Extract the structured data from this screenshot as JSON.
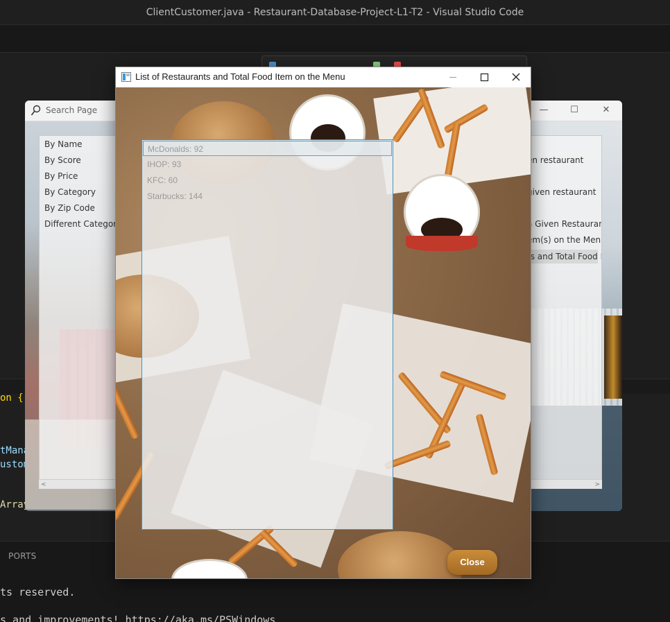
{
  "vscode": {
    "title": "ClientCustomer.java - Restaurant-Database-Project-L1-T2 - Visual Studio Code",
    "code_lines": [
      "on {",
      "tMana",
      "ustom",
      "Array"
    ],
    "panel_tab": "PORTS",
    "terminal_lines": [
      "ts reserved.",
      "s and improvements! https://aka.ms/PSWindows"
    ]
  },
  "left_window": {
    "search_label": "Search Page",
    "items": [
      "By Name",
      "By Score",
      "By Price",
      "By Category",
      "By Zip Code",
      "Different Category"
    ],
    "scroll_left": "<"
  },
  "right_window": {
    "items": [
      "en restaurant",
      "given restaurant",
      "a Given Restaurant",
      "em(s) on the Menu i",
      "ts and Total Food It"
    ],
    "scroll_right": ">"
  },
  "dialog": {
    "title": "List of Restaurants and Total Food Item on the Menu",
    "items": [
      "McDonalds: 92",
      "IHOP: 93",
      "KFC: 60",
      "Starbucks: 144"
    ],
    "close_label": "Close"
  },
  "colors": {
    "accent": "#4a92b8",
    "close_button": "#b8792c"
  }
}
